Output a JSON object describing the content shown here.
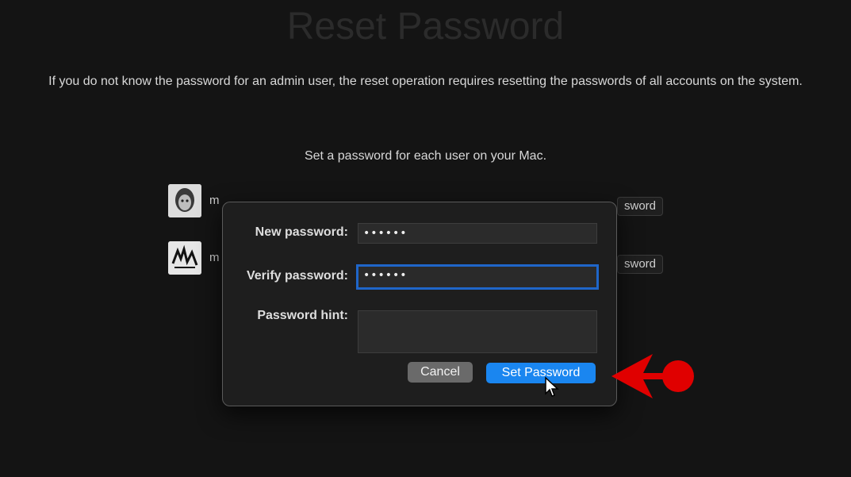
{
  "page": {
    "title": "Reset Password",
    "intro": "If you do not know the password for an admin user, the reset operation requires resetting the passwords of all accounts on the system.",
    "subtitle": "Set a password for each user on your Mac."
  },
  "users": [
    {
      "name_partial": "m",
      "avatar_icon": "user-photo-avatar",
      "button_label_partial": "sword"
    },
    {
      "name_partial": "m",
      "avatar_icon": "user-logo-avatar",
      "button_label_partial": "sword"
    }
  ],
  "dialog": {
    "new_password_label": "New password:",
    "new_password_value": "••••••",
    "verify_password_label": "Verify password:",
    "verify_password_value": "••••••",
    "hint_label": "Password hint:",
    "hint_value": "",
    "cancel_label": "Cancel",
    "set_password_label": "Set Password"
  },
  "colors": {
    "background": "#141414",
    "dialog_bg": "#1e1e1e",
    "primary_button": "#1a86f0",
    "focus_ring": "#1f66c9",
    "annotation_red": "#e00000"
  },
  "annotations": {
    "cursor_icon": "pointer-cursor-icon",
    "arrow_icon": "red-pointing-arrow-icon"
  }
}
